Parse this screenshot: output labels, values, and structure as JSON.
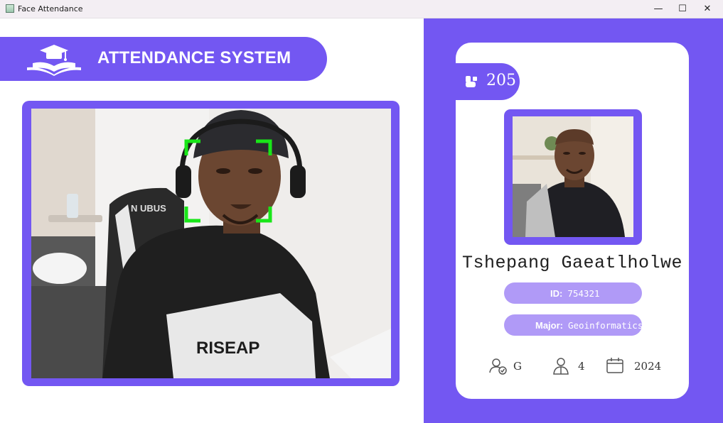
{
  "window": {
    "title": "Face Attendance",
    "buttons": {
      "minimize": "—",
      "maximize": "☐",
      "close": "✕"
    }
  },
  "header": {
    "title": "ATTENDANCE SYSTEM",
    "icon": "graduation-cap-book-icon"
  },
  "camera": {
    "feed": "live-webcam-feed",
    "face_box_color": "#19e619"
  },
  "student": {
    "attendance_count": "205",
    "name": "Tshepang Gaeatlholwe",
    "id_label": "ID:",
    "id_value": "754321",
    "major_label": "Major:",
    "major_value": "Geoinformatics",
    "standing": "G",
    "year": "4",
    "starting_year": "2024"
  },
  "icons": {
    "count": "user-contact-icon",
    "standing": "user-check-icon",
    "year": "student-user-icon",
    "starting_year": "calendar-icon"
  },
  "colors": {
    "accent": "#7357f2",
    "pill": "#b09af7",
    "card": "#ffffff"
  }
}
